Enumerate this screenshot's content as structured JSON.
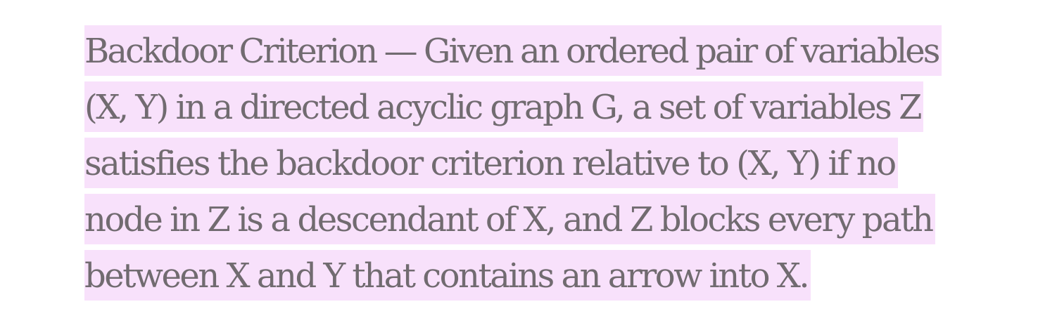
{
  "document": {
    "highlight_color": "#f8e1fb",
    "text_color": "#716b70",
    "lines": [
      "Backdoor Criterion — Given an ordered pair of variables",
      "(X, Y) in a directed acyclic graph G, a set of variables Z",
      "satisfies the backdoor criterion relative to (X, Y) if no",
      "node in Z is a descendant of X, and Z blocks every path",
      "between X and Y that contains an arrow into X."
    ]
  }
}
